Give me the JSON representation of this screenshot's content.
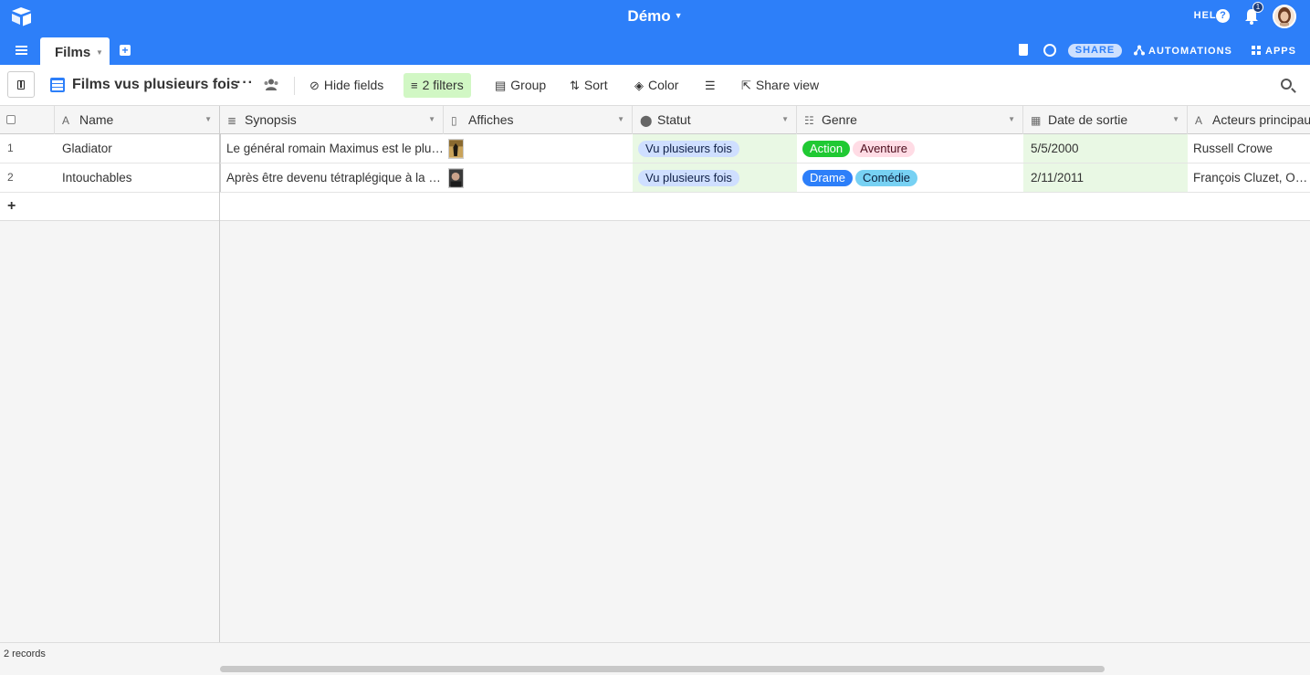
{
  "topbar": {
    "base_title": "Démo",
    "help_label": "HELP",
    "notification_count": "1",
    "brand_color": "#2d7ff9"
  },
  "tabbar": {
    "active_tab": "Films",
    "share_label": "SHARE",
    "automations_label": "AUTOMATIONS",
    "apps_label": "APPS"
  },
  "viewbar": {
    "view_name": "Films vus plusieurs fois",
    "more_label": "···",
    "hide_fields_label": "Hide fields",
    "filters_label": "2 filters",
    "group_label": "Group",
    "sort_label": "Sort",
    "color_label": "Color",
    "share_view_label": "Share view"
  },
  "columns": [
    {
      "name": "Name",
      "icon": "text-icon"
    },
    {
      "name": "Synopsis",
      "icon": "long-text-icon"
    },
    {
      "name": "Affiches",
      "icon": "attachment-icon"
    },
    {
      "name": "Statut",
      "icon": "single-select-icon"
    },
    {
      "name": "Genre",
      "icon": "multi-select-icon"
    },
    {
      "name": "Date de sortie",
      "icon": "calendar-icon"
    },
    {
      "name": "Acteurs principaux",
      "icon": "text-icon"
    }
  ],
  "rows": [
    {
      "num": "1",
      "name": "Gladiator",
      "synopsis": "Le général romain Maximus est le plus fidèle soutien de l'empereur Marc Aurèle",
      "statut": "Vu plusieurs fois",
      "genres": [
        "Action",
        "Aventure"
      ],
      "date": "5/5/2000",
      "acteurs": "Russell Crowe"
    },
    {
      "num": "2",
      "name": "Intouchables",
      "synopsis": "Après être devenu tétraplégique à la suite d'un accident de parapente",
      "statut": "Vu plusieurs fois",
      "genres": [
        "Drame",
        "Comédie"
      ],
      "date": "2/11/2011",
      "acteurs": "François Cluzet, Omar Sy"
    }
  ],
  "footer": {
    "records_label": "2 records"
  },
  "colors": {
    "filter_bg": "#d1f7c4",
    "statut_pill": "#cfdfff",
    "action_pill": "#20c933",
    "aventure_pill": "#ffdce5",
    "drame_pill": "#2d7ff9",
    "comedie_pill": "#77d1f3",
    "highlight_cell": "#e9f8e4"
  }
}
